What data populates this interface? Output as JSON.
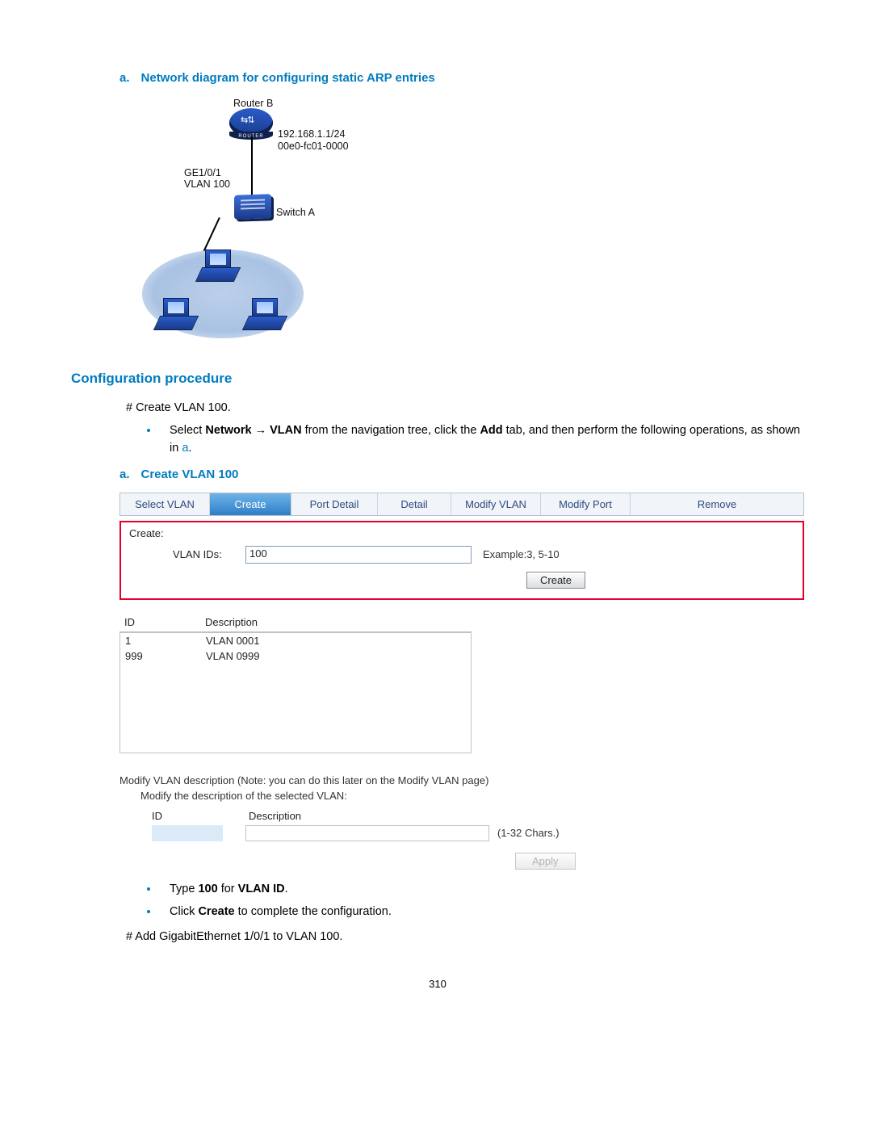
{
  "section_a": {
    "prefix": "a.",
    "title": "Network diagram for configuring static ARP entries"
  },
  "diagram": {
    "routerB": "Router B",
    "ip": "192.168.1.1/24",
    "mac": "00e0-fc01-0000",
    "ge": "GE1/0/1",
    "vlan": "VLAN 100",
    "switchA": "Switch A",
    "router_label": "ROUTER"
  },
  "heading_config": "Configuration procedure",
  "step1": "# Create VLAN 100.",
  "step1_bullet_pre": "Select ",
  "step1_bullet_b1": "Network",
  "step1_bullet_arrow": " → ",
  "step1_bullet_b2": "VLAN",
  "step1_bullet_mid": " from the navigation tree, click the ",
  "step1_bullet_b3": "Add",
  "step1_bullet_post": " tab, and then perform the following operations, as shown in ",
  "step1_bullet_link": "a",
  "step1_bullet_end": ".",
  "section_a2": {
    "prefix": "a.",
    "title": "Create VLAN 100"
  },
  "ui": {
    "tabs": [
      "Select VLAN",
      "Create",
      "Port Detail",
      "Detail",
      "Modify VLAN",
      "Modify Port",
      "Remove"
    ],
    "create_label": "Create:",
    "vlan_ids_label": "VLAN IDs:",
    "vlan_ids_value": "100",
    "example": "Example:3, 5-10",
    "create_btn": "Create",
    "col_id": "ID",
    "col_desc": "Description",
    "rows": [
      {
        "id": "1",
        "desc": "VLAN 0001"
      },
      {
        "id": "999",
        "desc": "VLAN 0999"
      }
    ],
    "modify_line": "Modify VLAN description (Note: you can do this later on the Modify VLAN page)",
    "modify_sub": "Modify the description of the selected VLAN:",
    "mod_id": "ID",
    "mod_desc": "Description",
    "mod_hint": "(1-32 Chars.)",
    "apply": "Apply"
  },
  "b2_pre": "Type ",
  "b2_b1": "100",
  "b2_mid": " for ",
  "b2_b2": "VLAN ID",
  "b2_end": ".",
  "b3_pre": "Click ",
  "b3_b1": "Create",
  "b3_end": " to complete the configuration.",
  "step_add": "# Add GigabitEthernet 1/0/1 to VLAN 100.",
  "page_num": "310"
}
